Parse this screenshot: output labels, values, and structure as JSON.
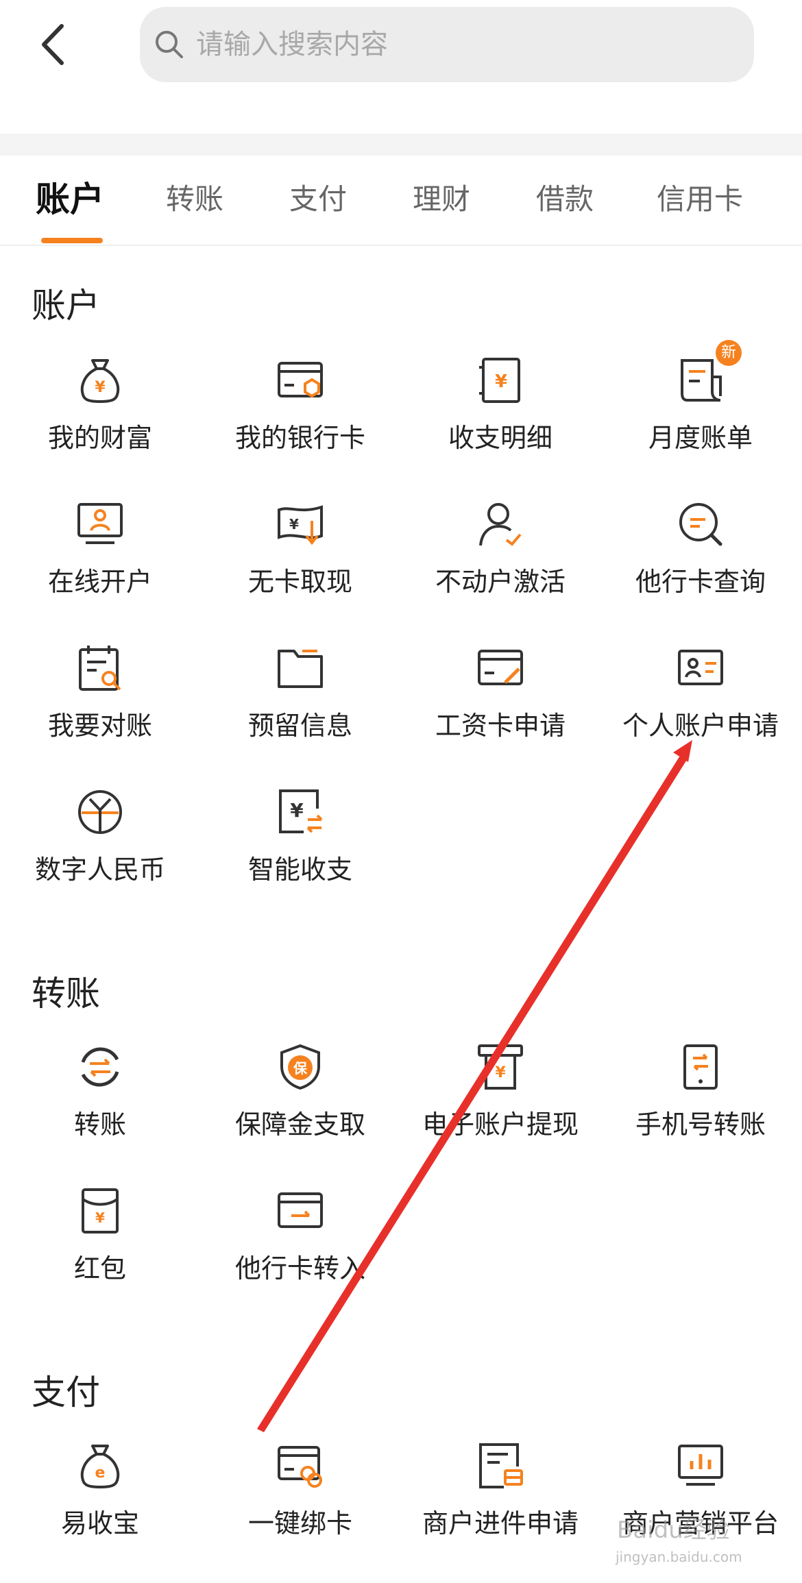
{
  "search": {
    "placeholder": "请输入搜索内容"
  },
  "tabs": [
    "账户",
    "转账",
    "支付",
    "理财",
    "借款",
    "信用卡"
  ],
  "sections": [
    {
      "title": "账户",
      "items": [
        {
          "label": "我的财富",
          "icon": "money-bag-icon"
        },
        {
          "label": "我的银行卡",
          "icon": "bank-card-icon"
        },
        {
          "label": "收支明细",
          "icon": "statement-icon"
        },
        {
          "label": "月度账单",
          "icon": "monthly-bill-icon",
          "badge": "新"
        },
        {
          "label": "在线开户",
          "icon": "online-account-icon"
        },
        {
          "label": "无卡取现",
          "icon": "cardless-withdraw-icon"
        },
        {
          "label": "不动户激活",
          "icon": "user-activate-icon"
        },
        {
          "label": "他行卡查询",
          "icon": "search-card-icon"
        },
        {
          "label": "我要对账",
          "icon": "reconcile-icon"
        },
        {
          "label": "预留信息",
          "icon": "folder-icon"
        },
        {
          "label": "工资卡申请",
          "icon": "salary-card-icon"
        },
        {
          "label": "个人账户申请",
          "icon": "id-card-icon"
        },
        {
          "label": "数字人民币",
          "icon": "digital-rmb-icon"
        },
        {
          "label": "智能收支",
          "icon": "smart-finance-icon"
        }
      ]
    },
    {
      "title": "转账",
      "items": [
        {
          "label": "转账",
          "icon": "transfer-icon"
        },
        {
          "label": "保障金支取",
          "icon": "shield-icon"
        },
        {
          "label": "电子账户提现",
          "icon": "atm-icon"
        },
        {
          "label": "手机号转账",
          "icon": "phone-transfer-icon"
        },
        {
          "label": "红包",
          "icon": "red-packet-icon"
        },
        {
          "label": "他行卡转入",
          "icon": "card-transfer-in-icon"
        }
      ]
    },
    {
      "title": "支付",
      "items": [
        {
          "label": "易收宝",
          "icon": "e-bag-icon"
        },
        {
          "label": "一键绑卡",
          "icon": "bind-card-icon"
        },
        {
          "label": "商户进件申请",
          "icon": "merchant-apply-icon"
        },
        {
          "label": "商户营销平台",
          "icon": "marketing-chart-icon"
        }
      ]
    }
  ],
  "watermark": {
    "main": "Baidu经验",
    "sub": "jingyan.baidu.com"
  },
  "colors": {
    "accent": "#f5821f",
    "icon": "#333333",
    "annotation": "#e8302a"
  }
}
